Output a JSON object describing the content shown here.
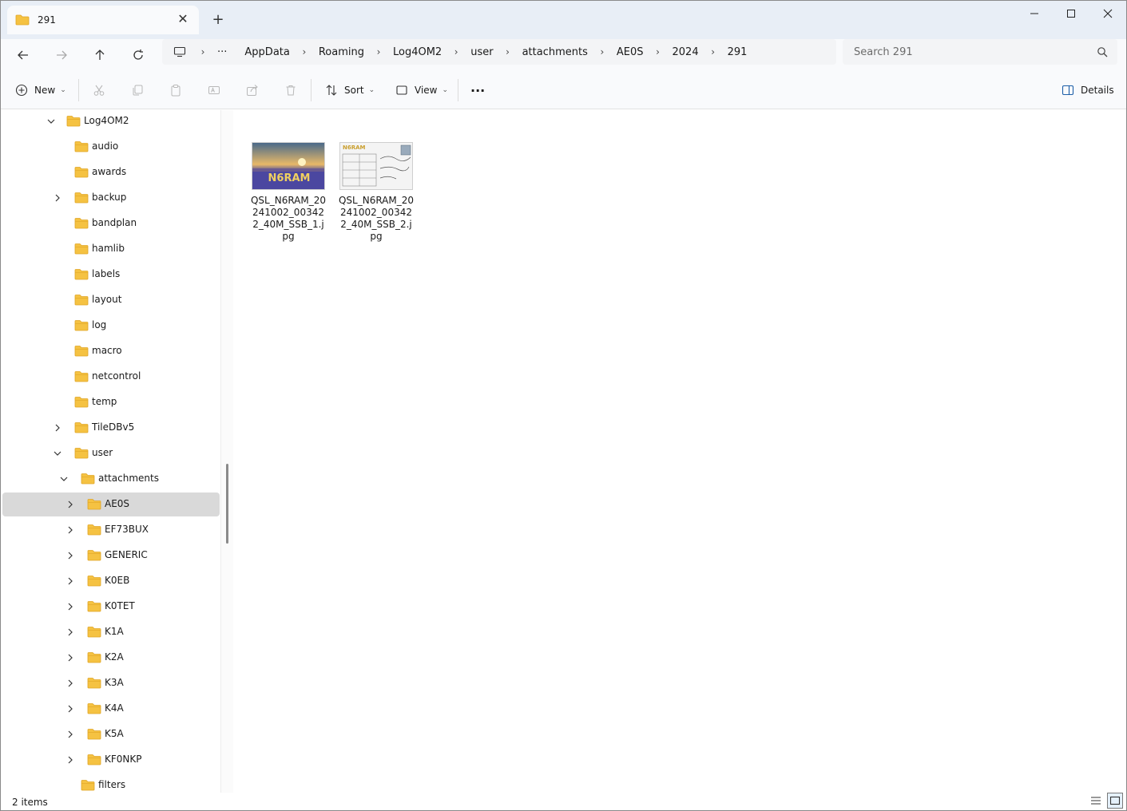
{
  "tab": {
    "title": "291",
    "close": "✕",
    "new_tab": "+"
  },
  "window_controls": {
    "minimize": "—",
    "maximize": "☐",
    "close": "✕"
  },
  "address": {
    "more": "···",
    "crumbs": [
      "AppData",
      "Roaming",
      "Log4OM2",
      "user",
      "attachments",
      "AE0S",
      "2024",
      "291"
    ]
  },
  "search": {
    "placeholder": "Search 291"
  },
  "commands": {
    "new_label": "New",
    "sort_label": "Sort",
    "view_label": "View",
    "more": "···",
    "details_label": "Details"
  },
  "tree": [
    {
      "label": "Log4OM2",
      "expanded": true
    },
    {
      "label": "audio"
    },
    {
      "label": "awards"
    },
    {
      "label": "backup",
      "has_children": true
    },
    {
      "label": "bandplan"
    },
    {
      "label": "hamlib"
    },
    {
      "label": "labels"
    },
    {
      "label": "layout"
    },
    {
      "label": "log"
    },
    {
      "label": "macro"
    },
    {
      "label": "netcontrol"
    },
    {
      "label": "temp"
    },
    {
      "label": "TileDBv5",
      "has_children": true
    },
    {
      "label": "user",
      "expanded": true
    },
    {
      "label": "attachments",
      "expanded": true
    },
    {
      "label": "AE0S",
      "has_children": true,
      "selected": true
    },
    {
      "label": "EF73BUX",
      "has_children": true
    },
    {
      "label": "GENERIC",
      "has_children": true
    },
    {
      "label": "K0EB",
      "has_children": true
    },
    {
      "label": "K0TET",
      "has_children": true
    },
    {
      "label": "K1A",
      "has_children": true
    },
    {
      "label": "K2A",
      "has_children": true
    },
    {
      "label": "K3A",
      "has_children": true
    },
    {
      "label": "K4A",
      "has_children": true
    },
    {
      "label": "K5A",
      "has_children": true
    },
    {
      "label": "KF0NKP",
      "has_children": true
    },
    {
      "label": "filters"
    }
  ],
  "files": [
    {
      "name": "QSL_N6RAM_20241002_003422_40M_SSB_1.jpg",
      "thumb_text": "N6RAM"
    },
    {
      "name": "QSL_N6RAM_20241002_003422_40M_SSB_2.jpg",
      "thumb_text": "N6RAM"
    }
  ],
  "status": {
    "count": "2 items"
  },
  "colors": {
    "folder": "#f5c242",
    "folder_dark": "#e0a526",
    "selected_bg": "#d9d9d9",
    "titlebar": "#e8eef6"
  }
}
